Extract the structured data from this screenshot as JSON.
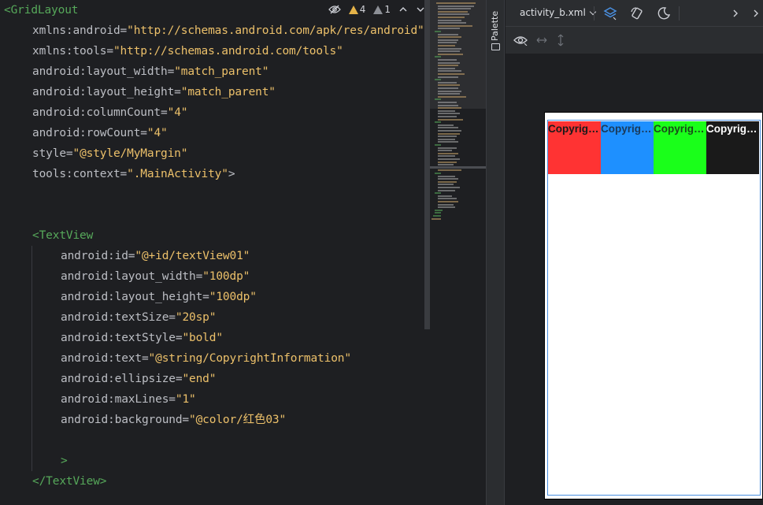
{
  "editor": {
    "inspection": {
      "warnings": "4",
      "weak_warnings": "1"
    },
    "lines": [
      {
        "indent": 0,
        "parts": [
          {
            "t": "tag",
            "v": "<GridLayout"
          }
        ]
      },
      {
        "indent": 1,
        "parts": [
          {
            "t": "attr",
            "v": "xmlns:android="
          },
          {
            "t": "val",
            "v": "\"http://schemas.android.com/apk/res/android\""
          }
        ]
      },
      {
        "indent": 1,
        "parts": [
          {
            "t": "attr",
            "v": "xmlns:tools="
          },
          {
            "t": "val",
            "v": "\"http://schemas.android.com/tools\""
          }
        ]
      },
      {
        "indent": 1,
        "parts": [
          {
            "t": "attr",
            "v": "android:layout_width="
          },
          {
            "t": "val",
            "v": "\"match_parent\""
          }
        ]
      },
      {
        "indent": 1,
        "parts": [
          {
            "t": "attr",
            "v": "android:layout_height="
          },
          {
            "t": "val",
            "v": "\"match_parent\""
          }
        ]
      },
      {
        "indent": 1,
        "parts": [
          {
            "t": "attr",
            "v": "android:columnCount="
          },
          {
            "t": "val",
            "v": "\"4\""
          }
        ]
      },
      {
        "indent": 1,
        "parts": [
          {
            "t": "attr",
            "v": "android:rowCount="
          },
          {
            "t": "val",
            "v": "\"4\""
          }
        ]
      },
      {
        "indent": 1,
        "parts": [
          {
            "t": "attr",
            "v": "style="
          },
          {
            "t": "val",
            "v": "\"@style/MyMargin\""
          }
        ]
      },
      {
        "indent": 1,
        "parts": [
          {
            "t": "attr",
            "v": "tools:context="
          },
          {
            "t": "val",
            "v": "\".MainActivity\""
          },
          {
            "t": "punct",
            "v": ">"
          }
        ]
      },
      {
        "indent": 0,
        "parts": []
      },
      {
        "indent": 0,
        "parts": []
      },
      {
        "indent": 1,
        "parts": [
          {
            "t": "tag",
            "v": "<TextView"
          }
        ]
      },
      {
        "indent": 2,
        "parts": [
          {
            "t": "attr",
            "v": "android:id="
          },
          {
            "t": "val",
            "v": "\"@+id/textView01\""
          }
        ]
      },
      {
        "indent": 2,
        "parts": [
          {
            "t": "attr",
            "v": "android:layout_width="
          },
          {
            "t": "val",
            "v": "\"100dp\""
          }
        ]
      },
      {
        "indent": 2,
        "parts": [
          {
            "t": "attr",
            "v": "android:layout_height="
          },
          {
            "t": "val",
            "v": "\"100dp\""
          }
        ]
      },
      {
        "indent": 2,
        "parts": [
          {
            "t": "attr",
            "v": "android:textSize="
          },
          {
            "t": "val",
            "v": "\"20sp\""
          }
        ]
      },
      {
        "indent": 2,
        "parts": [
          {
            "t": "attr",
            "v": "android:textStyle="
          },
          {
            "t": "val",
            "v": "\"bold\""
          }
        ]
      },
      {
        "indent": 2,
        "parts": [
          {
            "t": "attr",
            "v": "android:text="
          },
          {
            "t": "val",
            "v": "\"@string/CopyrightInformation\""
          }
        ]
      },
      {
        "indent": 2,
        "parts": [
          {
            "t": "attr",
            "v": "android:ellipsize="
          },
          {
            "t": "val",
            "v": "\"end\""
          }
        ]
      },
      {
        "indent": 2,
        "parts": [
          {
            "t": "attr",
            "v": "android:maxLines="
          },
          {
            "t": "val",
            "v": "\"1\""
          }
        ]
      },
      {
        "indent": 2,
        "parts": [
          {
            "t": "attr",
            "v": "android:background="
          },
          {
            "t": "val",
            "v": "\"@color/红色03\""
          }
        ]
      },
      {
        "indent": 0,
        "parts": []
      },
      {
        "indent": 2,
        "parts": [
          {
            "t": "tag",
            "v": ">"
          }
        ]
      },
      {
        "indent": 1,
        "parts": [
          {
            "t": "tag",
            "v": "</TextView>"
          }
        ]
      }
    ]
  },
  "palette": {
    "label": "Palette"
  },
  "preview": {
    "file_name": "activity_b.xml",
    "cells": [
      {
        "text": "Copyright...",
        "bg": "#ff3333",
        "fg": "#1a1a1a"
      },
      {
        "text": "Copyright...",
        "bg": "#1e90ff",
        "fg": "#1a3a5a"
      },
      {
        "text": "Copyright...",
        "bg": "#1aff1a",
        "fg": "#1a4a1a"
      },
      {
        "text": "Copyright...",
        "bg": "#1a1a1a",
        "fg": "#ffffff"
      }
    ]
  }
}
